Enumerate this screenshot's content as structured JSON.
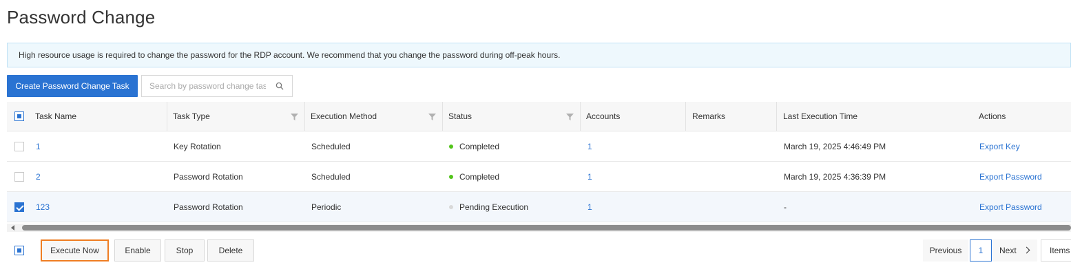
{
  "page": {
    "title": "Password Change"
  },
  "notice": {
    "text": "High resource usage is required to change the password for the RDP account. We recommend that you change the password during off-peak hours."
  },
  "toolbar": {
    "create_label": "Create Password Change Task",
    "search_placeholder": "Search by password change tas..."
  },
  "table": {
    "columns": [
      "Task Name",
      "Task Type",
      "Execution Method",
      "Status",
      "Accounts",
      "Remarks",
      "Last Execution Time",
      "Actions"
    ],
    "rows": [
      {
        "name": "1",
        "type": "Key Rotation",
        "method": "Scheduled",
        "status": "Completed",
        "status_color": "#52c41a",
        "accounts": "1",
        "remarks": "",
        "last_time": "March 19, 2025 4:46:49 PM",
        "action": "Export Key",
        "selected": false
      },
      {
        "name": "2",
        "type": "Password Rotation",
        "method": "Scheduled",
        "status": "Completed",
        "status_color": "#52c41a",
        "accounts": "1",
        "remarks": "",
        "last_time": "March 19, 2025 4:36:39 PM",
        "action": "Export Password",
        "selected": false
      },
      {
        "name": "123",
        "type": "Password Rotation",
        "method": "Periodic",
        "status": "Pending Execution",
        "status_color": "#d9d9d9",
        "accounts": "1",
        "remarks": "",
        "last_time": "-",
        "action": "Export Password",
        "selected": true
      }
    ]
  },
  "footer": {
    "execute_label": "Execute Now",
    "enable_label": "Enable",
    "stop_label": "Stop",
    "delete_label": "Delete"
  },
  "pagination": {
    "previous": "Previous",
    "current_page": "1",
    "next": "Next",
    "items_label": "Items"
  },
  "colors": {
    "primary": "#2a73d2",
    "highlight": "#ef7d22",
    "success": "#52c41a",
    "pending": "#d9d9d9"
  }
}
